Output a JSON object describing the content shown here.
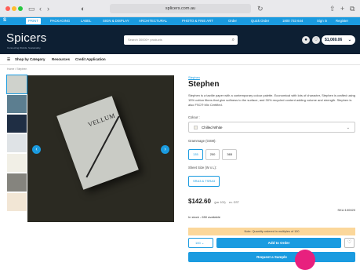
{
  "browser": {
    "url": "splicers.com.au"
  },
  "topnav": {
    "tabs": [
      "PRINT",
      "PACKAGING",
      "LABEL",
      "SIGN & DISPLAY",
      "ARCHITECTURAL",
      "PHOTO & FINE ART"
    ],
    "links": [
      "Order",
      "Quick Order",
      "1800 733 644",
      "Sign in",
      "Register"
    ]
  },
  "header": {
    "brand": "Spicers",
    "brand_tagline": "Connecting Worlds. Sustainably.",
    "search_placeholder": "Search 30000+ products",
    "cart_total": "$1,069.06"
  },
  "subnav": [
    "Shop by Category",
    "Resources",
    "Credit Application"
  ],
  "breadcrumb": "Home / Stephen",
  "gallery": {
    "thumb_colors": [
      "#cfd2cc",
      "#5c7e90",
      "#1f2e44",
      "#dfe3e6",
      "#f1efe6",
      "#85847e",
      "#f2e6d5"
    ],
    "cover_title": "VELLUM"
  },
  "product": {
    "brand": "Stephen",
    "title": "Stephen",
    "description": "Stephen is a tactile paper with a contemporary colour palette. Economical with lots of character, Stephen is crafted using 15% cotton fibers that give softness to the surface, and 30% recycled content adding volume and strength. Stephen is also FSC® Mix Certified.",
    "colour_label": "Colour :",
    "colour_value": "Chilled White",
    "grammage_label": "Grammage (GSM):",
    "grammage_options": [
      "135",
      "200",
      "365"
    ],
    "grammage_selected": "135",
    "sheet_label": "Sheet Size (W x L):",
    "sheet_options": [
      "SRA3 & TSRA3"
    ],
    "price": "$142.60",
    "price_unit": "(per 100)",
    "price_note": "ex. GST",
    "stock": "In stock - 650 available",
    "sku": "SKU:100020",
    "quantity_note": "Note: Quantity ordered in multiples of 100",
    "qty": "100",
    "add_to_order": "Add to Order",
    "request_sample": "Request a Sample"
  }
}
